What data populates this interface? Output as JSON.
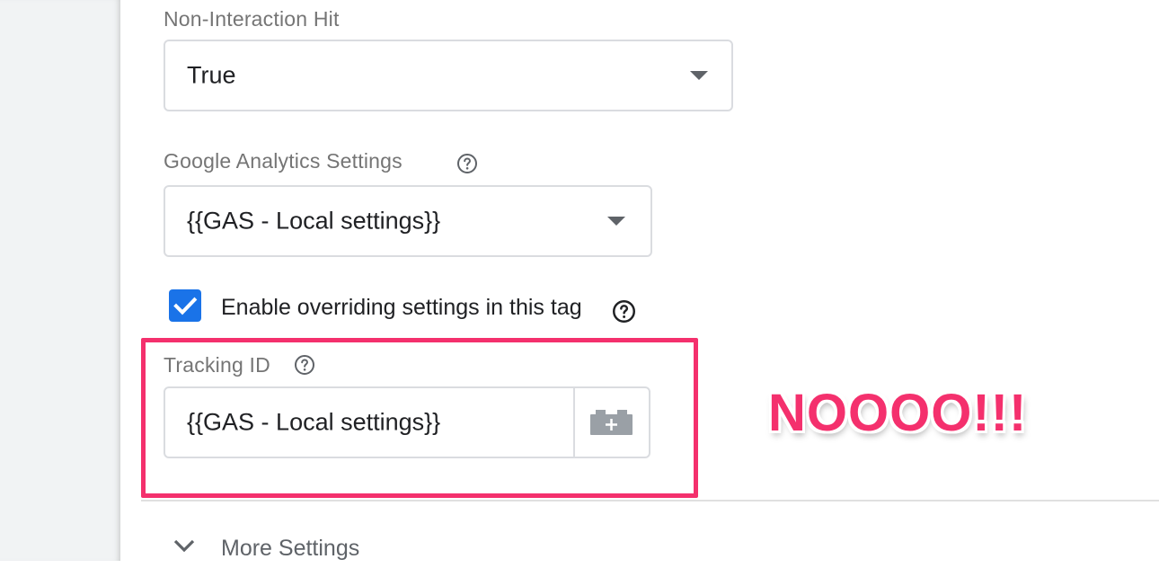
{
  "non_interaction": {
    "label": "Non-Interaction Hit",
    "value": "True"
  },
  "ga_settings": {
    "label": "Google Analytics Settings",
    "value": "{{GAS - Local settings}}"
  },
  "override": {
    "checked": true,
    "label": "Enable overriding settings in this tag"
  },
  "tracking_id": {
    "label": "Tracking ID",
    "value": "{{GAS - Local settings}}"
  },
  "annotation": {
    "text": "NOOOO!!!"
  },
  "more_settings": {
    "label": "More Settings"
  },
  "icons": {
    "help": "help-circle-icon",
    "dropdown": "caret-down-icon",
    "variable_picker": "add-variable-icon",
    "expand": "chevron-down-icon",
    "check": "check-icon"
  },
  "colors": {
    "accent": "#1a73e8",
    "highlight": "#f4306d"
  }
}
